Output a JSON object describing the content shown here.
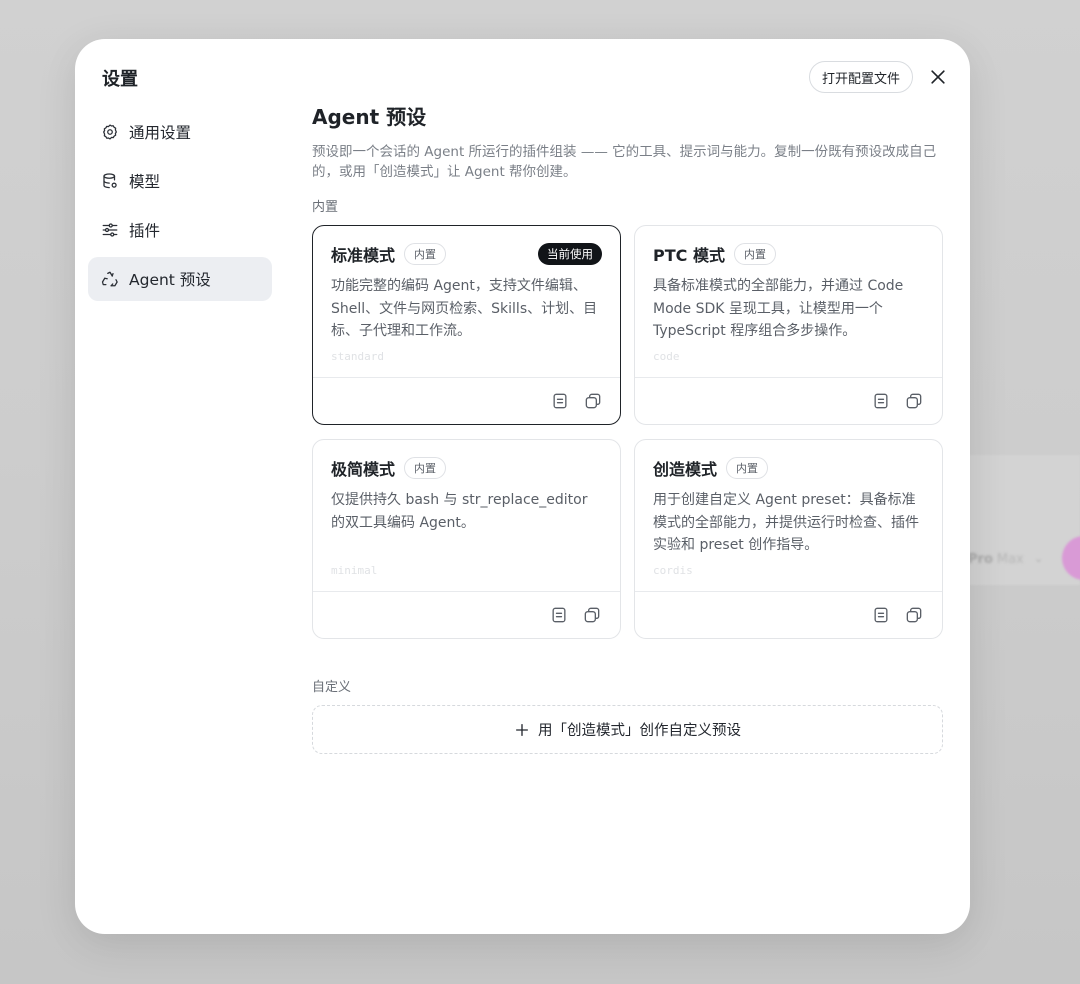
{
  "modal": {
    "title": "设置",
    "open_config_label": "打开配置文件"
  },
  "sidebar": {
    "items": [
      {
        "label": "通用设置",
        "icon": "gear-icon",
        "active": false
      },
      {
        "label": "模型",
        "icon": "database-icon",
        "active": false
      },
      {
        "label": "插件",
        "icon": "sliders-icon",
        "active": false
      },
      {
        "label": "Agent 预设",
        "icon": "recycle-icon",
        "active": true
      }
    ]
  },
  "main": {
    "title": "Agent 预设",
    "description": "预设即一个会话的 Agent 所运行的插件组装 —— 它的工具、提示词与能力。复制一份既有预设改成自己的，或用「创造模式」让 Agent 帮你创建。",
    "builtin_label": "内置",
    "custom_label": "自定义",
    "add_custom_label": "用「创造模式」创作自定义预设"
  },
  "presets": [
    {
      "title": "标准模式",
      "badge": "内置",
      "current_badge": "当前使用",
      "description": "功能完整的编码 Agent，支持文件编辑、Shell、文件与网页检索、Skills、计划、目标、子代理和工作流。",
      "code": "standard"
    },
    {
      "title": "PTC 模式",
      "badge": "内置",
      "description": "具备标准模式的全部能力，并通过 Code Mode SDK 呈现工具，让模型用一个 TypeScript 程序组合多步操作。",
      "code": "code"
    },
    {
      "title": "极简模式",
      "badge": "内置",
      "description": "仅提供持久 bash 与 str_replace_editor 的双工具编码 Agent。",
      "code": "minimal"
    },
    {
      "title": "创造模式",
      "badge": "内置",
      "description": "用于创建自定义 Agent preset：具备标准模式的全部能力，并提供运行时检查、插件实验和 preset 创作指导。",
      "code": "cordis"
    }
  ],
  "background": {
    "model_label": "Pro",
    "model_sub": "Max"
  },
  "colors": {
    "active_nav_bg": "#eceef2",
    "current_badge_bg": "#111418",
    "muted_text": "#7a7f87"
  }
}
